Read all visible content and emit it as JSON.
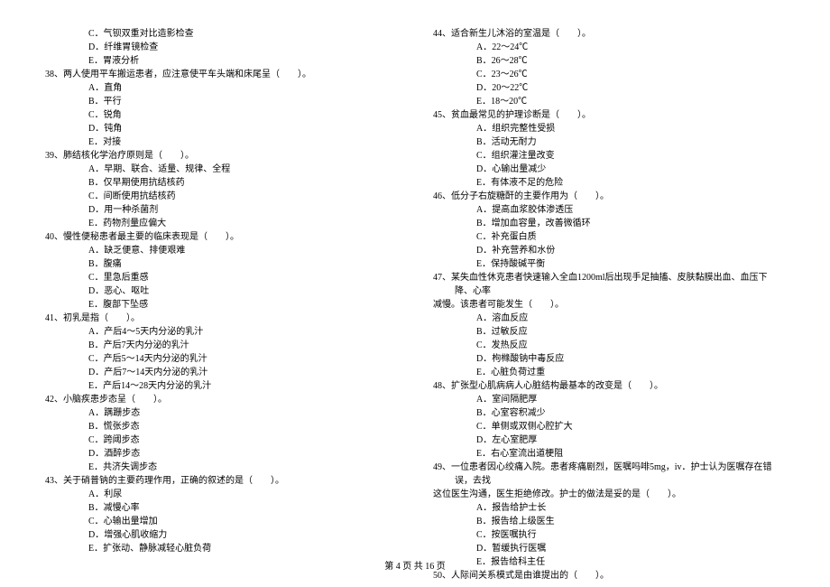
{
  "left": {
    "pre_opts": [
      "C．气钡双重对比造影检查",
      "D．纤维胃镜检查",
      "E．胃液分析"
    ],
    "q38": {
      "text": "38、两人使用平车搬运患者，应注意使平车头端和床尾呈（　　）。",
      "opts": [
        "A．直角",
        "B．平行",
        "C．锐角",
        "D．钝角",
        "E．对接"
      ]
    },
    "q39": {
      "text": "39、肺结核化学治疗原则是（　　）。",
      "opts": [
        "A．早期、联合、适量、规律、全程",
        "B．仅早期使用抗结核药",
        "C．间断使用抗结核药",
        "D．用一种杀菌剂",
        "E．药物剂量应偏大"
      ]
    },
    "q40": {
      "text": "40、慢性便秘患者最主要的临床表现是（　　）。",
      "opts": [
        "A．缺乏便意、排便艰难",
        "B．腹痛",
        "C．里急后重感",
        "D．恶心、呕吐",
        "E．腹部下坠感"
      ]
    },
    "q41": {
      "text": "41、初乳是指（　　）。",
      "opts": [
        "A．产后4～5天内分泌的乳汁",
        "B．产后7天内分泌的乳汁",
        "C．产后5～14天内分泌的乳汁",
        "D．产后7～14天内分泌的乳汁",
        "E．产后14～28天内分泌的乳汁"
      ]
    },
    "q42": {
      "text": "42、小脑疾患步态呈（　　）。",
      "opts": [
        "A．蹒跚步态",
        "B．慌张步态",
        "C．跨阈步态",
        "D．酒醉步态",
        "E．共济失调步态"
      ]
    },
    "q43": {
      "text": "43、关于硝普钠的主要药理作用，正确的叙述的是（　　）。",
      "opts": [
        "A．利尿",
        "B．减慢心率",
        "C．心输出量增加",
        "D．增强心肌收缩力",
        "E．扩张动、静脉减轻心脏负荷"
      ]
    }
  },
  "right": {
    "q44": {
      "text": "44、适合新生儿沐浴的室温是（　　）。",
      "opts": [
        "A．22～24℃",
        "B．26～28℃",
        "C．23～26℃",
        "D．20～22℃",
        "E．18～20℃"
      ]
    },
    "q45": {
      "text": "45、贫血最常见的护理诊断是（　　）。",
      "opts": [
        "A．组织完整性受损",
        "B．活动无耐力",
        "C．组织灌注量改变",
        "D．心输出量减少",
        "E．有体液不足的危险"
      ]
    },
    "q46": {
      "text": "46、低分子右旋糖酐的主要作用为（　　）。",
      "opts": [
        "A．提高血浆胶体渗透压",
        "B．增加血容量，改善微循环",
        "C．补充蛋白质",
        "D．补充营养和水份",
        "E．保持酸碱平衡"
      ]
    },
    "q47": {
      "text": "47、某失血性休克患者快速输入全血1200ml后出现手足抽搐、皮肤黏膜出血、血压下降、心率",
      "cont": "减慢。该患者可能发生（　　）。",
      "opts": [
        "A．溶血反应",
        "B．过敏反应",
        "C．发热反应",
        "D．枸橼酸钠中毒反应",
        "E．心脏负荷过重"
      ]
    },
    "q48": {
      "text": "48、扩张型心肌病病人心脏结构最基本的改变是（　　）。",
      "opts": [
        "A．室间隔肥厚",
        "B．心室容积减少",
        "C．单侧或双侧心腔扩大",
        "D．左心室肥厚",
        "E．右心室流出道梗阻"
      ]
    },
    "q49": {
      "text": "49、一位患者因心绞痛入院。患者疼痛剧烈，医嘱吗啡5mg，iv．护士认为医嘱存在错误，去找",
      "cont": "这位医生沟通，医生拒绝修改。护士的做法是妥的是（　　）。",
      "opts": [
        "A．报告给护士长",
        "B．报告给上级医生",
        "C．按医嘱执行",
        "D．暂缓执行医嘱",
        "E．报告给科主任"
      ]
    },
    "q50": {
      "text": "50、人际间关系模式是由谁提出的（　　）。"
    }
  },
  "footer": "第 4 页  共 16 页"
}
